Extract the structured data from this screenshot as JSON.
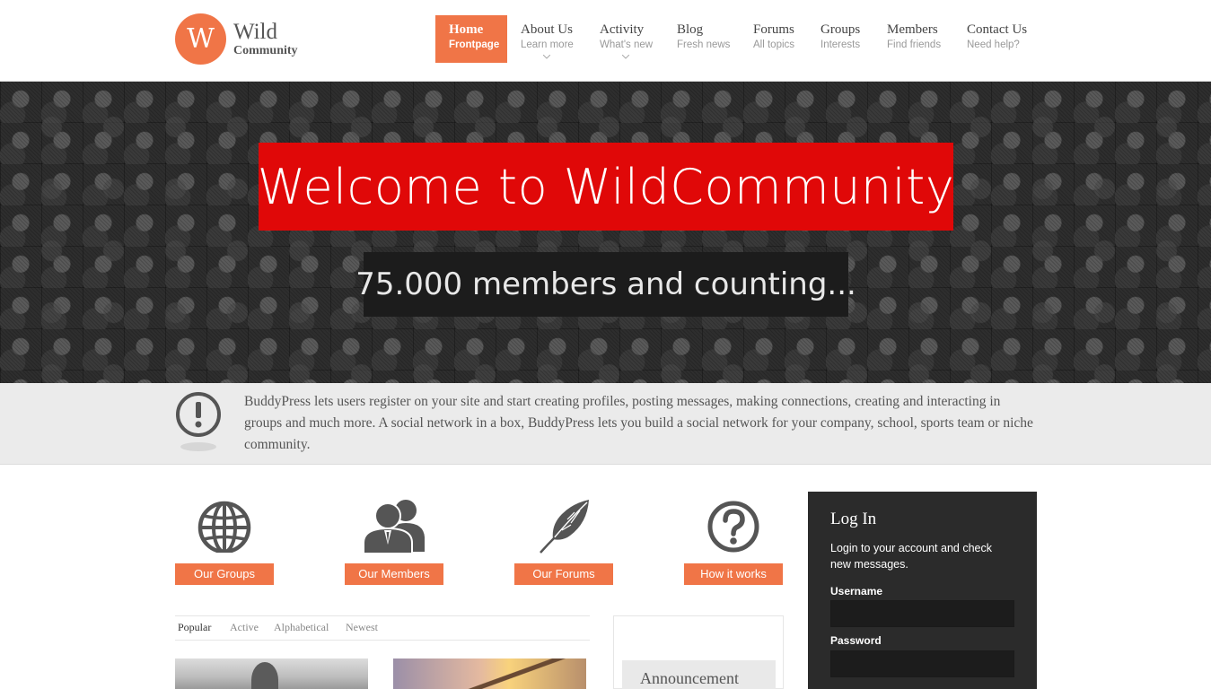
{
  "brand": {
    "logo_letter": "W",
    "name_line1": "Wild",
    "name_line2": "Community",
    "accent_color": "#f07547"
  },
  "nav": {
    "items": [
      {
        "title": "Home",
        "sub": "Frontpage",
        "active": true
      },
      {
        "title": "About Us",
        "sub": "Learn more",
        "dropdown": true
      },
      {
        "title": "Activity",
        "sub": "What's new",
        "dropdown": true
      },
      {
        "title": "Blog",
        "sub": "Fresh news"
      },
      {
        "title": "Forums",
        "sub": "All topics"
      },
      {
        "title": "Groups",
        "sub": "Interests"
      },
      {
        "title": "Members",
        "sub": "Find friends"
      },
      {
        "title": "Contact Us",
        "sub": "Need help?"
      }
    ]
  },
  "hero": {
    "title": "Welcome to WildCommunity",
    "subtitle": "75.000 members and counting...",
    "title_bg": "#e00808"
  },
  "info": {
    "icon": "exclamation-circle-icon",
    "text": "BuddyPress lets users register on your site and start creating profiles, posting messages, making connections, creating and interacting in groups and much more. A social network in a box, BuddyPress lets you build a social network for your company, school, sports team or niche community."
  },
  "features": [
    {
      "icon": "globe-icon",
      "label": "Our Groups"
    },
    {
      "icon": "members-icon",
      "label": "Our Members"
    },
    {
      "icon": "feather-icon",
      "label": "Our Forums"
    },
    {
      "icon": "question-circle-icon",
      "label": "How it works"
    }
  ],
  "tabs": [
    {
      "label": "Popular",
      "active": true
    },
    {
      "label": "Active"
    },
    {
      "label": "Alphabetical"
    },
    {
      "label": "Newest"
    }
  ],
  "announcement": {
    "title": "Announcement"
  },
  "login": {
    "title": "Log In",
    "description": "Login to your account and check new messages.",
    "username_label": "Username",
    "username_value": "",
    "password_label": "Password",
    "password_value": ""
  }
}
